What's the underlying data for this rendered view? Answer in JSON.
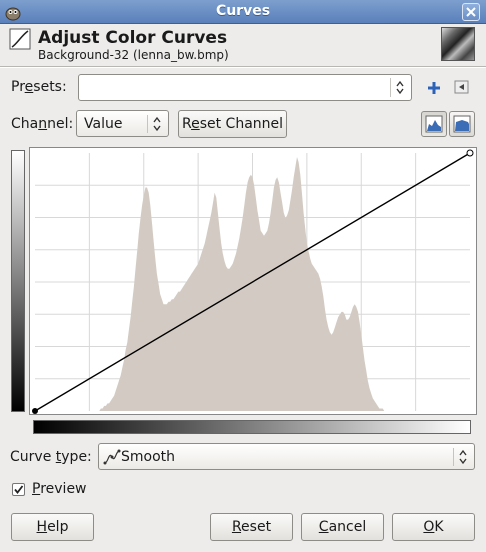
{
  "window": {
    "title": "Curves",
    "header_title": "Adjust Color Curves",
    "header_subtitle": "Background-32 (lenna_bw.bmp)"
  },
  "presets": {
    "label_pre": "Pr",
    "label_mnemonic": "e",
    "label_post": "sets:",
    "value": ""
  },
  "channel": {
    "label_pre": "Cha",
    "label_mnemonic": "n",
    "label_post": "nel:",
    "value": "Value",
    "reset_pre": "R",
    "reset_mnemonic": "e",
    "reset_post": "set Channel"
  },
  "curve_type": {
    "label_pre": "Curve ",
    "label_mnemonic": "t",
    "label_post": "ype:",
    "value": "Smooth"
  },
  "preview": {
    "mnemonic": "P",
    "label_rest": "review",
    "checked": true
  },
  "buttons": {
    "help_mnemonic": "H",
    "help_rest": "elp",
    "reset_mnemonic": "R",
    "reset_rest": "eset",
    "cancel_mnemonic": "C",
    "cancel_rest": "ancel",
    "ok_mnemonic": "O",
    "ok_rest": "K"
  },
  "curve": {
    "points": [
      [
        0,
        0
      ],
      [
        255,
        255
      ]
    ],
    "histogram": [
      0,
      0,
      0,
      0,
      0,
      0,
      0,
      0,
      0,
      0,
      0,
      0,
      0,
      0,
      0,
      0,
      0,
      0,
      0,
      0,
      0,
      0,
      0,
      0,
      0,
      0,
      0,
      0,
      0,
      0,
      0,
      0,
      0,
      0,
      0,
      0,
      0,
      0,
      0,
      0,
      1,
      1,
      2,
      2,
      3,
      3,
      4,
      5,
      6,
      8,
      10,
      12,
      14,
      17,
      20,
      24,
      27,
      32,
      37,
      43,
      49,
      56,
      63,
      70,
      76,
      81,
      85,
      88,
      88,
      86,
      81,
      74,
      67,
      60,
      54,
      50,
      46,
      44,
      42,
      42,
      42,
      43,
      43,
      44,
      44,
      45,
      46,
      47,
      47,
      48,
      49,
      50,
      51,
      52,
      53,
      54,
      55,
      56,
      57,
      58,
      60,
      62,
      64,
      66,
      69,
      72,
      75,
      78,
      82,
      86,
      84,
      78,
      72,
      66,
      62,
      59,
      57,
      56,
      56,
      57,
      58,
      60,
      62,
      65,
      68,
      72,
      76,
      81,
      86,
      90,
      92,
      93,
      92,
      89,
      84,
      79,
      75,
      71,
      70,
      69,
      70,
      71,
      74,
      78,
      83,
      88,
      91,
      92,
      90,
      86,
      82,
      78,
      76,
      77,
      79,
      83,
      87,
      92,
      96,
      100,
      98,
      93,
      86,
      78,
      72,
      66,
      63,
      60,
      58,
      57,
      56,
      55,
      54,
      52,
      49,
      45,
      40,
      36,
      33,
      31,
      30,
      31,
      33,
      35,
      37,
      38,
      39,
      39,
      38,
      36,
      36,
      37,
      39,
      41,
      42,
      41,
      39,
      35,
      30,
      25,
      20,
      16,
      12,
      9,
      7,
      5,
      4,
      3,
      2,
      1,
      1,
      1,
      0,
      0,
      0,
      0,
      0,
      0,
      0,
      0,
      0,
      0,
      0,
      0,
      0,
      0,
      0,
      0,
      0,
      0,
      0,
      0,
      0,
      0,
      0,
      0,
      0,
      0,
      0,
      0,
      0,
      0,
      0,
      0,
      0,
      0,
      0,
      0,
      0,
      0,
      0,
      0,
      0,
      0,
      0,
      0,
      0,
      0,
      0,
      0,
      0,
      0,
      0,
      0,
      0
    ]
  }
}
